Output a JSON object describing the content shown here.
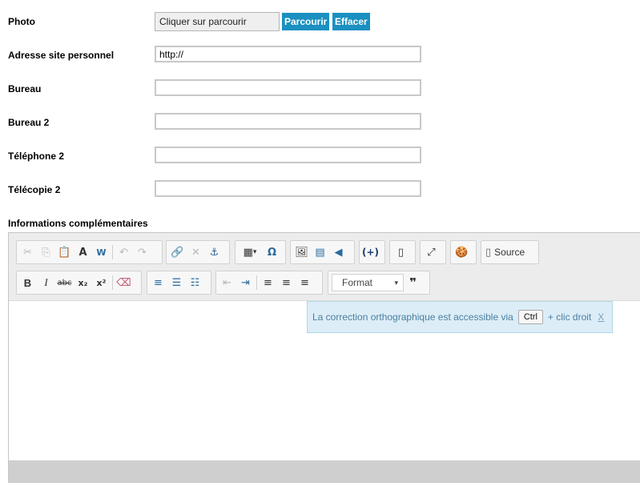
{
  "form": {
    "photo_label": "Photo",
    "photo_placeholder": "Cliquer sur parcourir",
    "browse_button": "Parcourir",
    "clear_button": "Effacer",
    "website_label": "Adresse site personnel",
    "website_value": "http://",
    "office_label": "Bureau",
    "office_value": "",
    "office2_label": "Bureau 2",
    "office2_value": "",
    "phone2_label": "Téléphone 2",
    "phone2_value": "",
    "fax2_label": "Télécopie 2",
    "fax2_value": "",
    "info_label": "Informations complémentaires"
  },
  "editor": {
    "source_label": "Source",
    "format_label": "Format",
    "notice_text": "La correction orthographique est accessible via",
    "notice_key": "Ctrl",
    "notice_suffix": "+ clic droit",
    "notice_close": "X",
    "icons": {
      "cut": "✂",
      "copy": "⎘",
      "paste": "📋",
      "paste_text": "A",
      "paste_word": "W",
      "undo": "↶",
      "redo": "↷",
      "link": "🔗",
      "unlink": "✕",
      "anchor": "⚓",
      "table": "▦",
      "special_char": "Ω",
      "image": "🖼",
      "flash": "▤",
      "audio": "◀",
      "placeholder": "(+)",
      "template": "▯",
      "maximize": "⤢",
      "cookie": "🍪",
      "bold": "B",
      "italic": "I",
      "strike": "abc",
      "subscript": "x₂",
      "superscript": "x²",
      "remove_format": "⌫",
      "numbered_list": "≡",
      "bulleted_list": "☰",
      "checklist": "☷",
      "outdent": "⇤",
      "indent": "⇥",
      "align_left": "≡",
      "align_center": "≡",
      "align_right": "≡",
      "blockquote": "❞",
      "dropdown_caret": "▾"
    }
  }
}
